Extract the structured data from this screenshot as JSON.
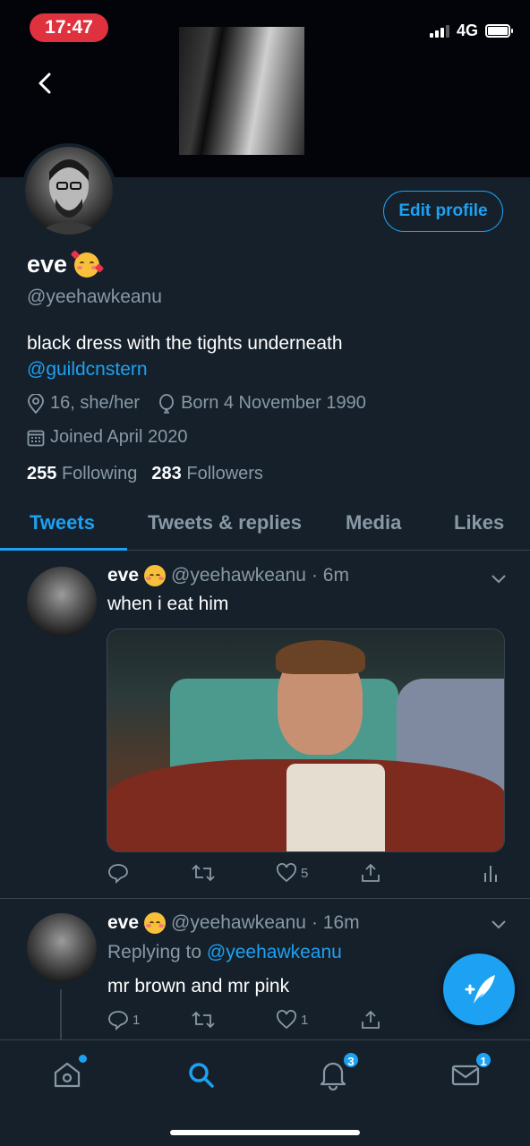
{
  "status_bar": {
    "time": "17:47",
    "network": "4G"
  },
  "profile": {
    "name": "eve",
    "handle": "@yeehawkeanu",
    "edit_button": "Edit profile",
    "bio": "black dress with the tights underneath",
    "bio_mention": "@guildcnstern",
    "location": "16, she/her",
    "birthday": "Born 4 November 1990",
    "joined": "Joined April 2020",
    "following_count": "255",
    "following_label": "Following",
    "followers_count": "283",
    "followers_label": "Followers"
  },
  "tabs": [
    {
      "label": "Tweets",
      "active": true
    },
    {
      "label": "Tweets & replies",
      "active": false
    },
    {
      "label": "Media",
      "active": false
    },
    {
      "label": "Likes",
      "active": false
    }
  ],
  "tweets": [
    {
      "name": "eve",
      "handle": "@yeehawkeanu",
      "time": "· 6m",
      "text": "when i eat him",
      "reply_count": "",
      "retweet_count": "",
      "like_count": "5"
    },
    {
      "name": "eve",
      "handle": "@yeehawkeanu",
      "time": "· 16m",
      "replying_prefix": "Replying to",
      "replying_to": "@yeehawkeanu",
      "text": "mr brown and mr pink",
      "reply_count": "1",
      "retweet_count": "",
      "like_count": "1"
    }
  ],
  "bottom_nav": {
    "notifications_badge": "3",
    "messages_badge": "1"
  },
  "colors": {
    "accent": "#1da1f2",
    "background": "#15202b",
    "muted": "#8899a6",
    "divider": "#38444d"
  },
  "icons": [
    "back-icon",
    "location-icon",
    "birthday-icon",
    "calendar-icon",
    "caret-down-icon",
    "reply-icon",
    "retweet-icon",
    "like-icon",
    "share-icon",
    "analytics-icon",
    "compose-icon",
    "home-icon",
    "search-icon",
    "notifications-icon",
    "messages-icon"
  ]
}
